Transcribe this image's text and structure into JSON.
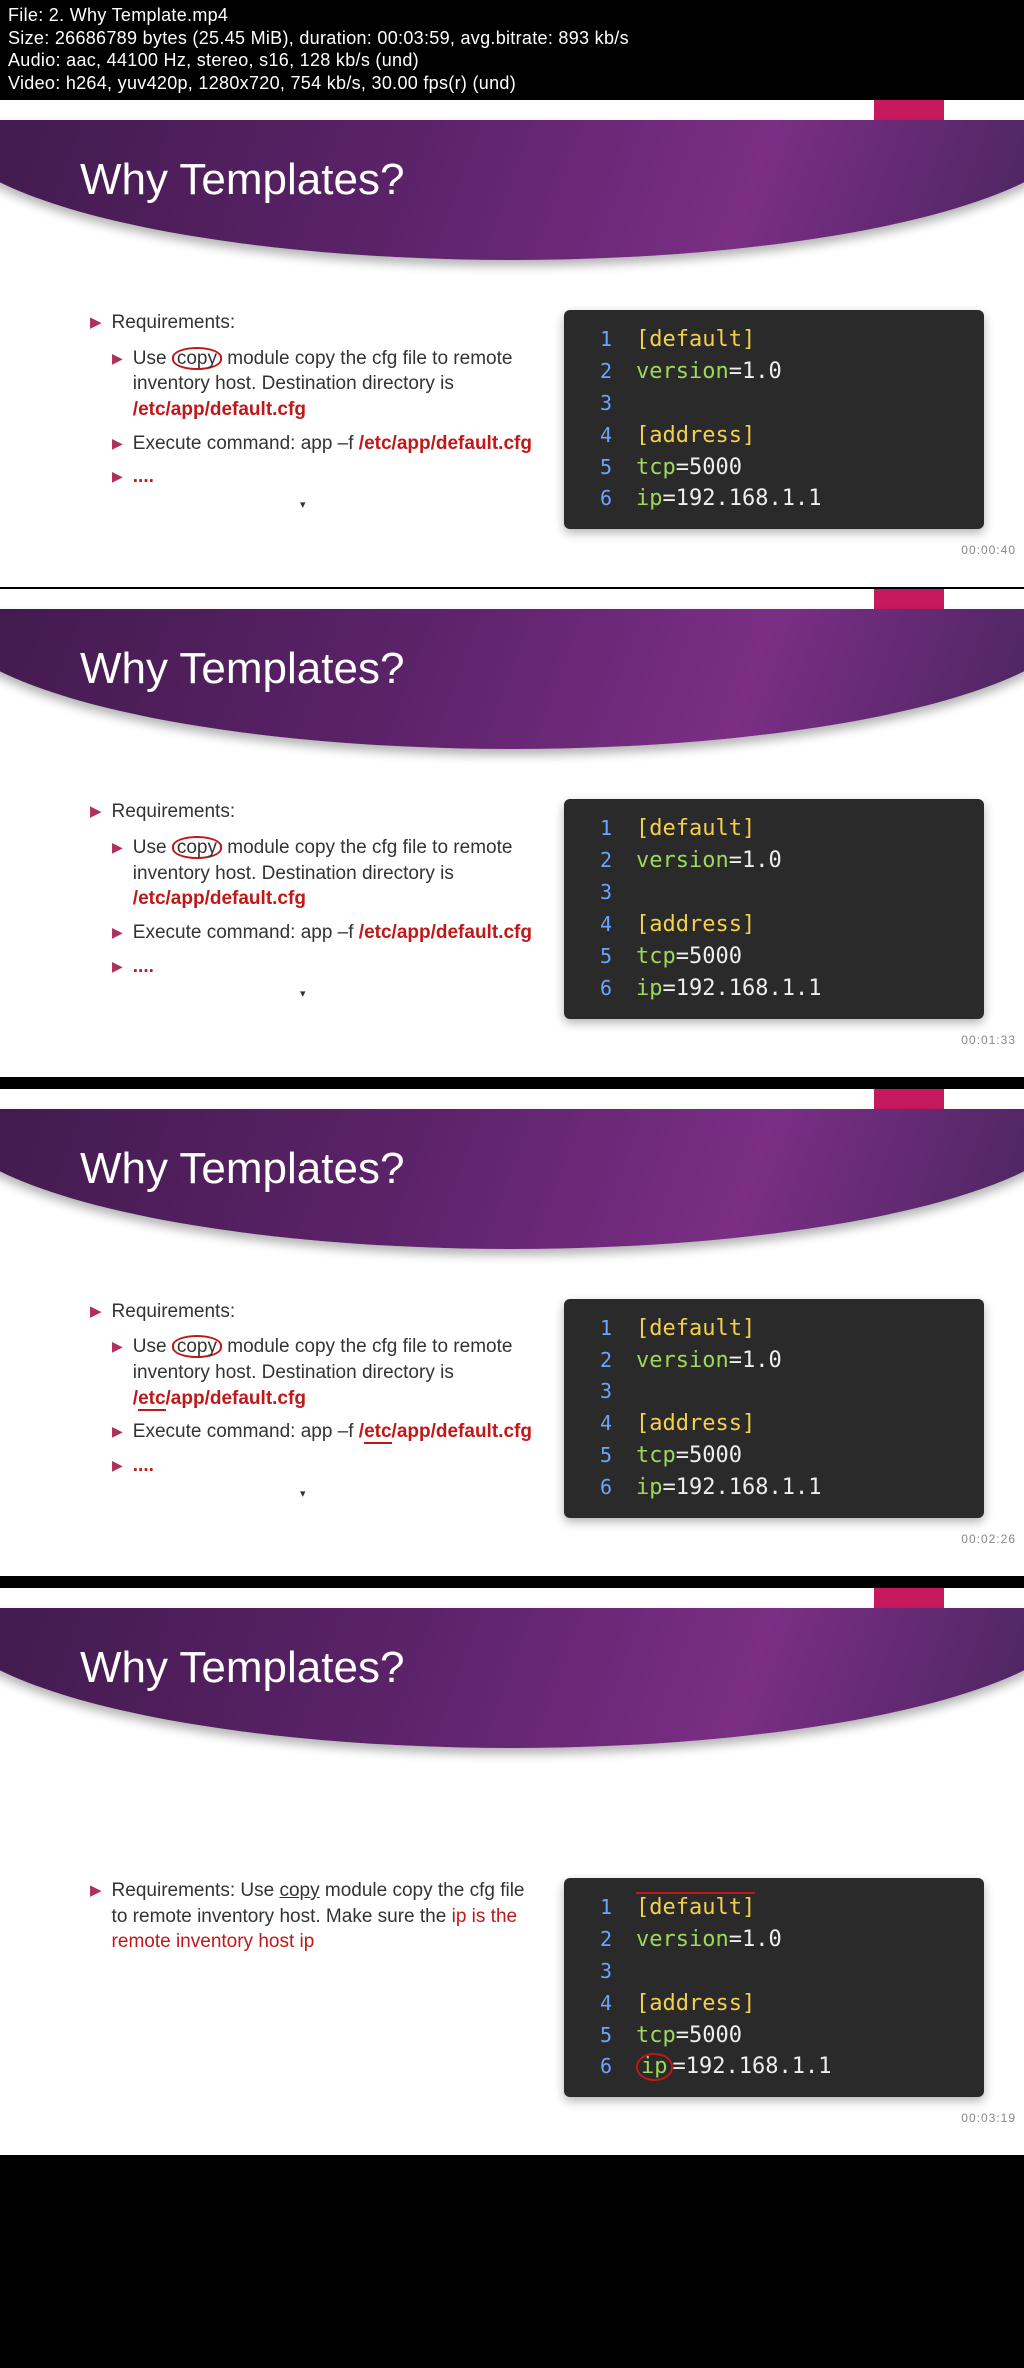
{
  "meta": {
    "file_line": "File: 2. Why Template.mp4",
    "size_line": "Size: 26686789 bytes (25.45 MiB), duration: 00:03:59, avg.bitrate: 893 kb/s",
    "audio_line": "Audio: aac, 44100 Hz, stereo, s16, 128 kb/s (und)",
    "video_line": "Video: h264, yuv420p, 1280x720, 754 kb/s, 30.00 fps(r) (und)"
  },
  "title": "Why Templates?",
  "req_label": "Requirements:",
  "use_pre": "Use ",
  "copy_word": "copy",
  "use_post": " module copy the cfg file to remote inventory host.  Destination directory is",
  "cfg_path_slash": "/",
  "cfg_path_etc": "etc",
  "cfg_path_rest": "/app/default.cfg",
  "exec_pre": "Execute command:  app –f ",
  "dots": "....",
  "req4_pre": "Requirements: Use ",
  "req4_mid": " module copy the cfg file to remote inventory host. Make sure the ",
  "req4_ip": "ip is the remote inventory host ip",
  "code": {
    "l1_n": "1",
    "l1": "[default]",
    "l2_n": "2",
    "l2_k": "version",
    "l2_eq": "=",
    "l2_v": "1.0",
    "l3_n": "3",
    "l4_n": "4",
    "l4": "[address]",
    "l5_n": "5",
    "l5_k": "tcp",
    "l5_eq": "=",
    "l5_v": "5000",
    "l6_n": "6",
    "l6_k": "ip",
    "l6_eq": "=",
    "l6_v": "192.168.1.1"
  },
  "ts1": "00:00:40",
  "ts2": "00:01:33",
  "ts3": "00:02:26",
  "ts4": "00:03:19"
}
